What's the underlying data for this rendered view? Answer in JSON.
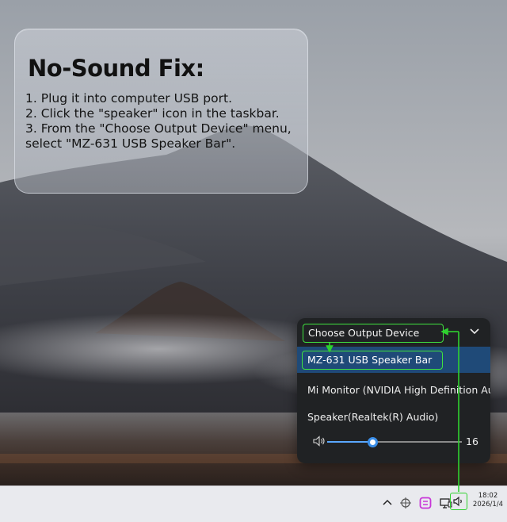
{
  "card": {
    "title": "No-Sound Fix:",
    "steps": [
      "1. Plug it into computer USB port.",
      "2. Click the \"speaker\" icon in the taskbar.",
      "3. From the \"Choose Output Device\" menu, select \"MZ-631 USB Speaker Bar\"."
    ]
  },
  "flyout": {
    "header": "Choose Output Device",
    "devices": [
      {
        "label": "MZ-631 USB Speaker Bar",
        "selected": true
      },
      {
        "label": "Mi Monitor (NVIDIA High Definition Audio",
        "selected": false
      },
      {
        "label": "Speaker(Realtek(R) Audio)",
        "selected": false
      }
    ],
    "volume": {
      "value": "16",
      "level": 0.16
    }
  },
  "taskbar": {
    "icons": [
      "chevron-up-icon",
      "network-icon",
      "app-icon",
      "display-icon",
      "speaker-icon"
    ],
    "clock": {
      "time": "18:02",
      "date": "2026/1/4"
    }
  },
  "colors": {
    "highlight": "#3fe33f",
    "selected_bg": "#1f4a78",
    "slider_accent": "#3a8ee8",
    "app_icon": "#c836d8"
  }
}
